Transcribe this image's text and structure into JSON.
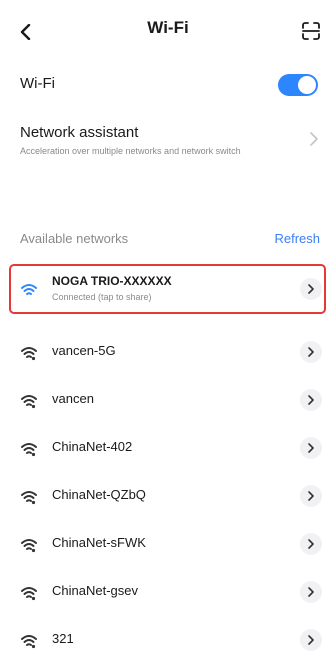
{
  "header": {
    "title": "Wi-Fi",
    "back_icon": "chevron-left-icon",
    "scan_icon": "scan-icon"
  },
  "wifi_toggle": {
    "label": "Wi-Fi",
    "on": true
  },
  "assistant": {
    "label": "Network assistant",
    "description": "Acceleration over multiple networks and network switch"
  },
  "available": {
    "section_label": "Available networks",
    "refresh_label": "Refresh"
  },
  "networks": [
    {
      "name": "NOGA TRIO-XXXXXX",
      "status": "Connected (tap to share)",
      "connected": true
    },
    {
      "name": "vancen-5G"
    },
    {
      "name": "vancen"
    },
    {
      "name": "ChinaNet-402"
    },
    {
      "name": "ChinaNet-QZbQ"
    },
    {
      "name": "ChinaNet-sFWK"
    },
    {
      "name": "ChinaNet-gsev"
    },
    {
      "name": "321"
    }
  ],
  "colors": {
    "accent": "#2e86ff",
    "refresh": "#3b7ff5",
    "highlight": "#e53935",
    "icon_dark": "#333333"
  }
}
